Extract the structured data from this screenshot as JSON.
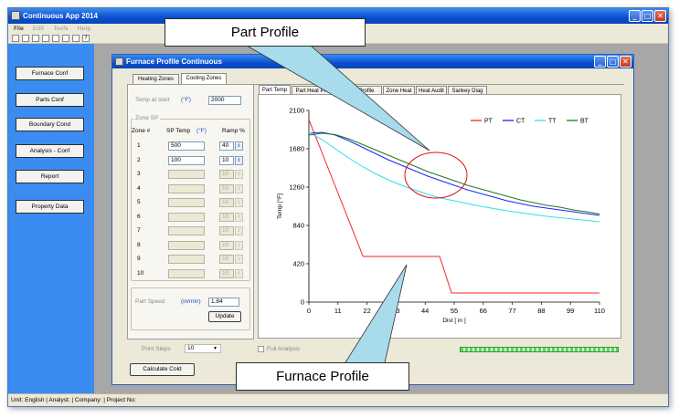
{
  "app": {
    "title": "Continuous App 2014",
    "menu": [
      "File",
      "Edit",
      "Tools",
      "Help"
    ],
    "sidebar": [
      "Furnace Conf",
      "Parts Conf",
      "Boundary Cond",
      "Analysis - Conf",
      "Report",
      "Property Data"
    ],
    "status": "Unit: English  | Analyst:    | Company:    | Project No:"
  },
  "child": {
    "title": "Furnace Profile Continuous",
    "outer_tabs": [
      "Heating Zones",
      "Cooling Zones"
    ],
    "temp_at_start_label": "Temp at start",
    "temp_unit": "(°F)",
    "temp_at_start_value": "2000",
    "zone_sp_title": "Zone SP",
    "col_zone": "Zone #",
    "col_sp_temp": "SP Temp",
    "col_sp_unit": "(°F)",
    "col_ramp": "Ramp %",
    "zones": [
      {
        "n": "1",
        "sp": "500",
        "ramp": "40",
        "enabled": true
      },
      {
        "n": "2",
        "sp": "100",
        "ramp": "10",
        "enabled": true
      },
      {
        "n": "3",
        "sp": "",
        "ramp": "10",
        "enabled": false
      },
      {
        "n": "4",
        "sp": "",
        "ramp": "10",
        "enabled": false
      },
      {
        "n": "5",
        "sp": "",
        "ramp": "10",
        "enabled": false
      },
      {
        "n": "6",
        "sp": "",
        "ramp": "10",
        "enabled": false
      },
      {
        "n": "7",
        "sp": "",
        "ramp": "10",
        "enabled": false
      },
      {
        "n": "8",
        "sp": "",
        "ramp": "10",
        "enabled": false
      },
      {
        "n": "9",
        "sp": "",
        "ramp": "10",
        "enabled": false
      },
      {
        "n": "10",
        "sp": "",
        "ramp": "10",
        "enabled": false
      }
    ],
    "part_speed_label": "Part Speed",
    "part_speed_unit": "(in/min)",
    "part_speed_value": "1.84",
    "update_label": "Update",
    "print_steps_label": "Print Steps",
    "print_steps_value": "10",
    "full_analysis_label": "Full Analysis",
    "calc_cold_label": "Calculate Cold",
    "chart_tabs": [
      "Part Temp",
      "Part Heat Profile",
      "Par Profile",
      "Zone Heat",
      "Heat Audit",
      "Sankey Diag"
    ]
  },
  "callouts": {
    "top": "Part Profile",
    "bottom": "Furnace Profile"
  },
  "colors": {
    "PT": "#ff2020",
    "CT": "#2020ff",
    "TT": "#30e0e8",
    "BT": "#1e7a1e"
  },
  "chart_data": {
    "type": "line",
    "xlabel": "Dist [ in ]",
    "ylabel": "Temp [°F]",
    "xlim": [
      0,
      110
    ],
    "ylim": [
      0,
      2100
    ],
    "xticks": [
      0,
      11,
      22,
      33,
      44,
      55,
      66,
      77,
      88,
      99,
      110
    ],
    "yticks": [
      0,
      420,
      840,
      1260,
      1680,
      2100
    ],
    "legend_position": "top-right",
    "series": [
      {
        "name": "PT",
        "x": [
          0,
          20.5,
          49.5,
          54,
          110
        ],
        "y": [
          2000,
          500,
          500,
          100,
          100
        ]
      },
      {
        "name": "CT",
        "x": [
          0,
          5,
          10,
          15,
          20,
          25,
          30,
          35,
          40,
          45,
          50,
          55,
          60,
          65,
          70,
          75,
          80,
          85,
          90,
          95,
          100,
          105,
          110
        ],
        "y": [
          1850,
          1860,
          1830,
          1770,
          1700,
          1630,
          1560,
          1500,
          1440,
          1380,
          1330,
          1280,
          1230,
          1190,
          1150,
          1110,
          1080,
          1050,
          1030,
          1010,
          990,
          970,
          950
        ]
      },
      {
        "name": "TT",
        "x": [
          0,
          5,
          10,
          15,
          20,
          25,
          30,
          35,
          40,
          45,
          50,
          55,
          60,
          65,
          70,
          75,
          80,
          85,
          90,
          95,
          100,
          105,
          110
        ],
        "y": [
          1860,
          1780,
          1680,
          1580,
          1490,
          1410,
          1340,
          1280,
          1230,
          1180,
          1140,
          1110,
          1080,
          1050,
          1025,
          1000,
          980,
          960,
          940,
          925,
          910,
          895,
          880
        ]
      },
      {
        "name": "BT",
        "x": [
          0,
          5,
          10,
          15,
          20,
          25,
          30,
          35,
          40,
          45,
          50,
          55,
          60,
          65,
          70,
          75,
          80,
          85,
          90,
          95,
          100,
          105,
          110
        ],
        "y": [
          1830,
          1850,
          1835,
          1790,
          1730,
          1670,
          1610,
          1550,
          1490,
          1430,
          1380,
          1330,
          1280,
          1240,
          1200,
          1160,
          1120,
          1090,
          1060,
          1040,
          1010,
          990,
          965
        ]
      }
    ]
  }
}
